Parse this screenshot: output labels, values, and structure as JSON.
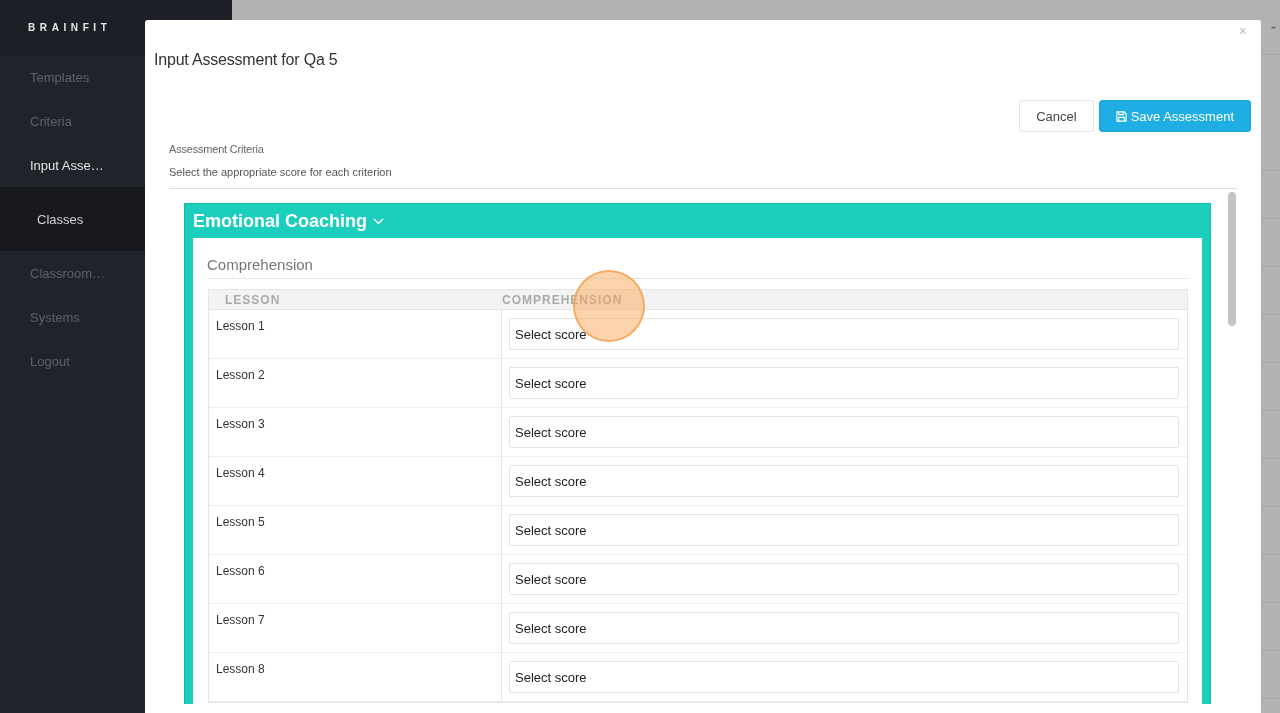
{
  "sidebar": {
    "logo": "BRAINFIT",
    "items": [
      {
        "label": "Templates",
        "selected": false
      },
      {
        "label": "Criteria",
        "selected": false
      },
      {
        "label": "Input Asse…",
        "selected": true,
        "expanded": true,
        "children": [
          {
            "label": "Classes",
            "selected": false
          }
        ]
      },
      {
        "label": "Classroom…",
        "selected": false
      },
      {
        "label": "Systems",
        "selected": false
      },
      {
        "label": "Logout",
        "selected": false
      }
    ]
  },
  "background_page": {
    "title_fragment": "-"
  },
  "modal": {
    "title": "Input Assessment for Qa 5",
    "close": "×",
    "buttons": [
      {
        "label": "Cancel",
        "kind": "default"
      },
      {
        "label": "Save Assessment",
        "kind": "primary"
      }
    ],
    "section_label": "Assessment Criteria",
    "instructions": "Select the appropriate score for each criterion",
    "panel": {
      "title": "Emotional Coaching",
      "expanded": true,
      "subtitle": "Comprehension",
      "table": {
        "columns": [
          "LESSON",
          "COMPREHENSION"
        ],
        "rows": [
          {
            "lesson": "Lesson 1",
            "placeholder": "Select score"
          },
          {
            "lesson": "Lesson 2",
            "placeholder": "Select score"
          },
          {
            "lesson": "Lesson 3",
            "placeholder": "Select score"
          },
          {
            "lesson": "Lesson 4",
            "placeholder": "Select score"
          },
          {
            "lesson": "Lesson 5",
            "placeholder": "Select score"
          },
          {
            "lesson": "Lesson 6",
            "placeholder": "Select score"
          },
          {
            "lesson": "Lesson 7",
            "placeholder": "Select score"
          },
          {
            "lesson": "Lesson 8",
            "placeholder": "Select score"
          }
        ]
      }
    }
  }
}
